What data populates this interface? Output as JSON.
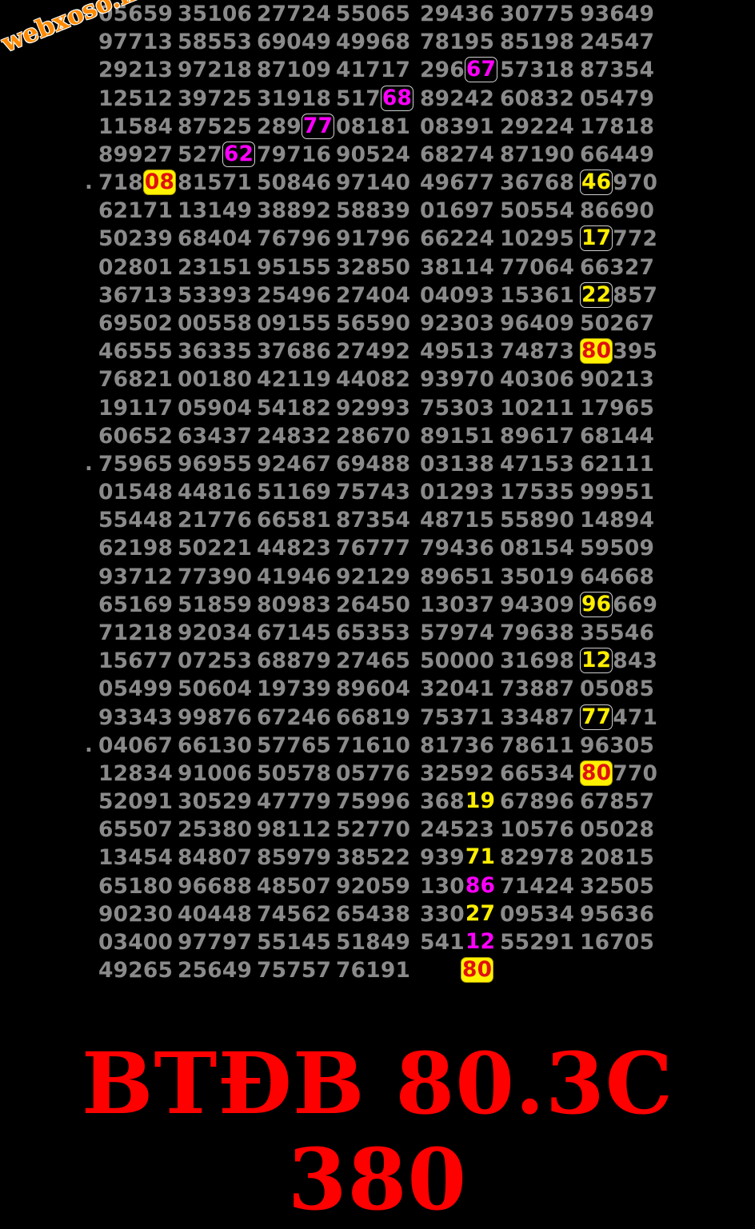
{
  "watermark": "webxoso.net",
  "banner": "BTĐB 80.3C 380",
  "colors": {
    "number_text": "#8a8a8a",
    "highlight_magenta": "#ff00ff",
    "highlight_yellow": "#ffee00",
    "highlight_red": "#e01010",
    "banner_red": "#ff0000",
    "watermark_orange": "#ff8a00",
    "background": "#000000"
  },
  "rows": [
    {
      "prefix": "",
      "cells": [
        [
          "05659"
        ],
        [
          "35106"
        ],
        [
          "27724"
        ],
        [
          "55065"
        ],
        [
          "29436"
        ],
        [
          "30775"
        ],
        [
          "93649"
        ]
      ]
    },
    {
      "prefix": "",
      "cells": [
        [
          "97713"
        ],
        [
          "58553"
        ],
        [
          "69049"
        ],
        [
          "49968"
        ],
        [
          "78195"
        ],
        [
          "85198"
        ],
        [
          "24547"
        ]
      ]
    },
    {
      "prefix": "",
      "cells": [
        [
          "29213"
        ],
        [
          "97218"
        ],
        [
          "87109"
        ],
        [
          "41717"
        ],
        [
          "296",
          {
            "t": "67",
            "s": "magenta-box"
          }
        ],
        [
          "57318"
        ],
        [
          "87354"
        ]
      ]
    },
    {
      "prefix": "",
      "cells": [
        [
          "12512"
        ],
        [
          "39725"
        ],
        [
          "31918"
        ],
        [
          "517",
          {
            "t": "68",
            "s": "magenta-box"
          }
        ],
        [
          "89242"
        ],
        [
          "60832"
        ],
        [
          "05479"
        ]
      ]
    },
    {
      "prefix": "",
      "cells": [
        [
          "11584"
        ],
        [
          "87525"
        ],
        [
          "289",
          {
            "t": "77",
            "s": "magenta-box"
          }
        ],
        [
          "08181"
        ],
        [
          "08391"
        ],
        [
          "29224"
        ],
        [
          "17818"
        ]
      ]
    },
    {
      "prefix": "",
      "cells": [
        [
          "89927"
        ],
        [
          "527",
          {
            "t": "62",
            "s": "magenta-box"
          }
        ],
        [
          "79716"
        ],
        [
          "90524"
        ],
        [
          "68274"
        ],
        [
          "87190"
        ],
        [
          "66449"
        ]
      ]
    },
    {
      "prefix": ".",
      "cells": [
        [
          "718",
          {
            "t": "08",
            "s": "red-on-yellow"
          }
        ],
        [
          "81571"
        ],
        [
          "50846"
        ],
        [
          "97140"
        ],
        [
          "49677"
        ],
        [
          "36768"
        ],
        [
          {
            "t": "46",
            "s": "yellow-box"
          },
          "970"
        ]
      ]
    },
    {
      "prefix": "",
      "cells": [
        [
          "62171"
        ],
        [
          "13149"
        ],
        [
          "38892"
        ],
        [
          "58839"
        ],
        [
          "01697"
        ],
        [
          "50554"
        ],
        [
          "86690"
        ]
      ]
    },
    {
      "prefix": "",
      "cells": [
        [
          "50239"
        ],
        [
          "68404"
        ],
        [
          "76796"
        ],
        [
          "91796"
        ],
        [
          "66224"
        ],
        [
          "10295"
        ],
        [
          {
            "t": "17",
            "s": "yellow-box"
          },
          "772"
        ]
      ]
    },
    {
      "prefix": "",
      "cells": [
        [
          "02801"
        ],
        [
          "23151"
        ],
        [
          "95155"
        ],
        [
          "32850"
        ],
        [
          "38114"
        ],
        [
          "77064"
        ],
        [
          "66327"
        ]
      ]
    },
    {
      "prefix": "",
      "cells": [
        [
          "36713"
        ],
        [
          "53393"
        ],
        [
          "25496"
        ],
        [
          "27404"
        ],
        [
          "04093"
        ],
        [
          "15361"
        ],
        [
          {
            "t": "22",
            "s": "yellow-box"
          },
          "857"
        ]
      ]
    },
    {
      "prefix": "",
      "cells": [
        [
          "69502"
        ],
        [
          "00558"
        ],
        [
          "09155"
        ],
        [
          "56590"
        ],
        [
          "92303"
        ],
        [
          "96409"
        ],
        [
          "50267"
        ]
      ]
    },
    {
      "prefix": "",
      "cells": [
        [
          "46555"
        ],
        [
          "36335"
        ],
        [
          "37686"
        ],
        [
          "27492"
        ],
        [
          "49513"
        ],
        [
          "74873"
        ],
        [
          {
            "t": "80",
            "s": "red-on-yellow"
          },
          "395"
        ]
      ]
    },
    {
      "prefix": "",
      "cells": [
        [
          "76821"
        ],
        [
          "00180"
        ],
        [
          "42119"
        ],
        [
          "44082"
        ],
        [
          "93970"
        ],
        [
          "40306"
        ],
        [
          "90213"
        ]
      ]
    },
    {
      "prefix": "",
      "cells": [
        [
          "19117"
        ],
        [
          "05904"
        ],
        [
          "54182"
        ],
        [
          "92993"
        ],
        [
          "75303"
        ],
        [
          "10211"
        ],
        [
          "17965"
        ]
      ]
    },
    {
      "prefix": "",
      "cells": [
        [
          "60652"
        ],
        [
          "63437"
        ],
        [
          "24832"
        ],
        [
          "28670"
        ],
        [
          "89151"
        ],
        [
          "89617"
        ],
        [
          "68144"
        ]
      ]
    },
    {
      "prefix": ".",
      "cells": [
        [
          "75965"
        ],
        [
          "96955"
        ],
        [
          "92467"
        ],
        [
          "69488"
        ],
        [
          "03138"
        ],
        [
          "47153"
        ],
        [
          "62111"
        ]
      ]
    },
    {
      "prefix": "",
      "cells": [
        [
          "01548"
        ],
        [
          "44816"
        ],
        [
          "51169"
        ],
        [
          "75743"
        ],
        [
          "01293"
        ],
        [
          "17535"
        ],
        [
          "99951"
        ]
      ]
    },
    {
      "prefix": "",
      "cells": [
        [
          "55448"
        ],
        [
          "21776"
        ],
        [
          "66581"
        ],
        [
          "87354"
        ],
        [
          "48715"
        ],
        [
          "55890"
        ],
        [
          "14894"
        ]
      ]
    },
    {
      "prefix": "",
      "cells": [
        [
          "62198"
        ],
        [
          "50221"
        ],
        [
          "44823"
        ],
        [
          "76777"
        ],
        [
          "79436"
        ],
        [
          "08154"
        ],
        [
          "59509"
        ]
      ]
    },
    {
      "prefix": "",
      "cells": [
        [
          "93712"
        ],
        [
          "77390"
        ],
        [
          "41946"
        ],
        [
          "92129"
        ],
        [
          "89651"
        ],
        [
          "35019"
        ],
        [
          "64668"
        ]
      ]
    },
    {
      "prefix": "",
      "cells": [
        [
          "65169"
        ],
        [
          "51859"
        ],
        [
          "80983"
        ],
        [
          "26450"
        ],
        [
          "13037"
        ],
        [
          "94309"
        ],
        [
          {
            "t": "96",
            "s": "yellow-box"
          },
          "669"
        ]
      ]
    },
    {
      "prefix": "",
      "cells": [
        [
          "71218"
        ],
        [
          "92034"
        ],
        [
          "67145"
        ],
        [
          "65353"
        ],
        [
          "57974"
        ],
        [
          "79638"
        ],
        [
          "35546"
        ]
      ]
    },
    {
      "prefix": "",
      "cells": [
        [
          "15677"
        ],
        [
          "07253"
        ],
        [
          "68879"
        ],
        [
          "27465"
        ],
        [
          "50000"
        ],
        [
          "31698"
        ],
        [
          {
            "t": "12",
            "s": "yellow-box"
          },
          "843"
        ]
      ]
    },
    {
      "prefix": "",
      "cells": [
        [
          "05499"
        ],
        [
          "50604"
        ],
        [
          "19739"
        ],
        [
          "89604"
        ],
        [
          "32041"
        ],
        [
          "73887"
        ],
        [
          "05085"
        ]
      ]
    },
    {
      "prefix": "",
      "cells": [
        [
          "93343"
        ],
        [
          "99876"
        ],
        [
          "67246"
        ],
        [
          "66819"
        ],
        [
          "75371"
        ],
        [
          "33487"
        ],
        [
          {
            "t": "77",
            "s": "yellow-box"
          },
          "471"
        ]
      ]
    },
    {
      "prefix": ".",
      "cells": [
        [
          "04067"
        ],
        [
          "66130"
        ],
        [
          "57765"
        ],
        [
          "71610"
        ],
        [
          "81736"
        ],
        [
          "78611"
        ],
        [
          "96305"
        ]
      ]
    },
    {
      "prefix": "",
      "cells": [
        [
          "12834"
        ],
        [
          "91006"
        ],
        [
          "50578"
        ],
        [
          "05776"
        ],
        [
          "32592"
        ],
        [
          "66534"
        ],
        [
          {
            "t": "80",
            "s": "red-on-yellow"
          },
          "770"
        ]
      ]
    },
    {
      "prefix": "",
      "cells": [
        [
          "52091"
        ],
        [
          "30529"
        ],
        [
          "47779"
        ],
        [
          "75996"
        ],
        [
          "368",
          {
            "t": "19",
            "s": "yellow-plain"
          }
        ],
        [
          "67896"
        ],
        [
          "67857"
        ]
      ]
    },
    {
      "prefix": "",
      "cells": [
        [
          "65507"
        ],
        [
          "25380"
        ],
        [
          "98112"
        ],
        [
          "52770"
        ],
        [
          "24523"
        ],
        [
          "10576"
        ],
        [
          "05028"
        ]
      ]
    },
    {
      "prefix": "",
      "cells": [
        [
          "13454"
        ],
        [
          "84807"
        ],
        [
          "85979"
        ],
        [
          "38522"
        ],
        [
          "939",
          {
            "t": "71",
            "s": "yellow-plain"
          }
        ],
        [
          "82978"
        ],
        [
          "20815"
        ]
      ]
    },
    {
      "prefix": "",
      "cells": [
        [
          "65180"
        ],
        [
          "96688"
        ],
        [
          "48507"
        ],
        [
          "92059"
        ],
        [
          "130",
          {
            "t": "86",
            "s": "magenta-plain"
          }
        ],
        [
          "71424"
        ],
        [
          "32505"
        ]
      ]
    },
    {
      "prefix": "",
      "cells": [
        [
          "90230"
        ],
        [
          "40448"
        ],
        [
          "74562"
        ],
        [
          "65438"
        ],
        [
          "330",
          {
            "t": "27",
            "s": "yellow-plain"
          }
        ],
        [
          "09534"
        ],
        [
          "95636"
        ]
      ]
    },
    {
      "prefix": "",
      "cells": [
        [
          "03400"
        ],
        [
          "97797"
        ],
        [
          "55145"
        ],
        [
          "51849"
        ],
        [
          "541",
          {
            "t": "12",
            "s": "magenta-plain"
          }
        ],
        [
          "55291"
        ],
        [
          "16705"
        ]
      ]
    },
    {
      "prefix": "",
      "cells": [
        [
          "49265"
        ],
        [
          "25649"
        ],
        [
          "75757"
        ],
        [
          "76191"
        ]
      ],
      "lone": {
        "t": "80",
        "s": "red-on-yellow"
      }
    }
  ]
}
